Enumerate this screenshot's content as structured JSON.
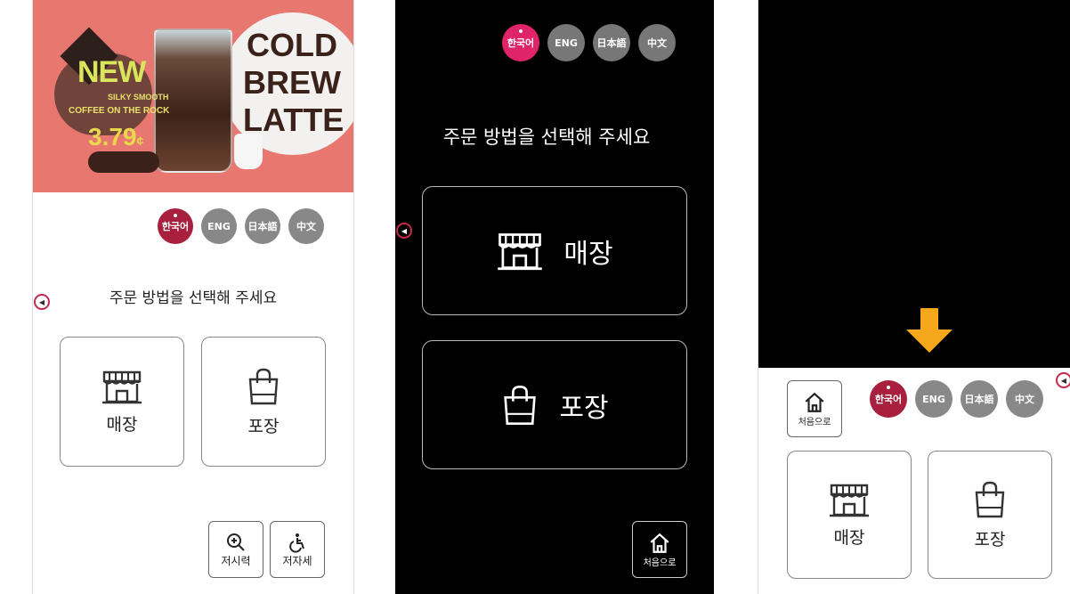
{
  "colors": {
    "active_lang": "#a8203e",
    "active_lang_dark": "#e0246a",
    "inactive_lang": "#888888",
    "banner_bg": "#e8776f",
    "arrow": "#f5a81b"
  },
  "panel1": {
    "banner": {
      "new": "NEW",
      "silky": "SILKY SMOOTH",
      "rock": "COFFEE ON THE ROCK",
      "price": "3.79",
      "price_unit": "¢",
      "product": "COLD BREW LATTE"
    },
    "langs": [
      "한국어",
      "ENG",
      "日本語",
      "中文"
    ],
    "prompt": "주문 방법을 선택해 주세요",
    "options": [
      {
        "label": "매장",
        "icon": "store-icon"
      },
      {
        "label": "포장",
        "icon": "bag-icon"
      }
    ],
    "zoom_label": "저시력",
    "wheelchair_label": "저자세"
  },
  "panel2": {
    "langs": [
      "한국어",
      "ENG",
      "日本語",
      "中文"
    ],
    "prompt": "주문 방법을 선택해 주세요",
    "options": [
      {
        "label": "매장",
        "icon": "store-icon"
      },
      {
        "label": "포장",
        "icon": "bag-icon"
      }
    ],
    "home_label": "처음으로"
  },
  "panel3": {
    "home_label": "처음으로",
    "langs": [
      "한국어",
      "ENG",
      "日本語",
      "中文"
    ],
    "options": [
      {
        "label": "매장",
        "icon": "store-icon"
      },
      {
        "label": "포장",
        "icon": "bag-icon"
      }
    ]
  }
}
